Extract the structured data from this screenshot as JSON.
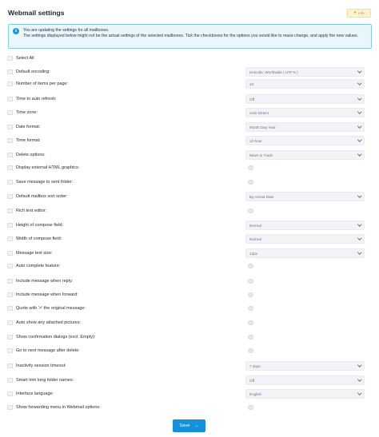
{
  "page": {
    "title": "Webmail settings",
    "info_label": "Info"
  },
  "notice": {
    "line1": "You are updating the settings for all mailboxes.",
    "line2": "The settings displayed below might not be the actual settings of the selected mailboxes. Tick the checkboxes for the options you would like to mass-change, and apply the new values."
  },
  "select_all": "Select All",
  "settings": [
    {
      "label": "Default encoding:",
      "type": "select",
      "value": "Unicode, Worldwide ( UTF-8 )"
    },
    {
      "label": "Number of items per page:",
      "type": "select",
      "value": "10"
    },
    {
      "label": "Time to auto refresh:",
      "type": "select",
      "value": "Off"
    },
    {
      "label": "Time zone:",
      "type": "select",
      "value": "Auto Detect"
    },
    {
      "label": "Date format:",
      "type": "select",
      "value": "Month Day Year"
    },
    {
      "label": "Time format:",
      "type": "select",
      "value": "12-hour"
    },
    {
      "label": "Delete options:",
      "type": "select",
      "value": "Move to Trash"
    },
    {
      "label": "Display external HTML graphics:",
      "type": "toggle"
    },
    {
      "label": "Save message to sent folder:",
      "type": "toggle"
    },
    {
      "label": "Default mailbox sort order:",
      "type": "select",
      "value": "By Arrival Date"
    },
    {
      "label": "Rich text editor:",
      "type": "toggle"
    },
    {
      "label": "Height of compose field:",
      "type": "select",
      "value": "Normal"
    },
    {
      "label": "Width of compose field:",
      "type": "select",
      "value": "Normal"
    },
    {
      "label": "Message text size:",
      "type": "select",
      "value": "12px"
    },
    {
      "label": "Auto complete feature:",
      "type": "toggle"
    },
    {
      "label": "Include message when reply:",
      "type": "toggle"
    },
    {
      "label": "Include message when forward:",
      "type": "toggle"
    },
    {
      "label": "Quote with '>' the original message:",
      "type": "toggle"
    },
    {
      "label": "Auto show any attached pictures:",
      "type": "toggle"
    },
    {
      "label": "Show confirmation dialogs (excl. Empty):",
      "type": "toggle"
    },
    {
      "label": "Go to next message after delete:",
      "type": "toggle"
    },
    {
      "label": "Inactivity session timeout:",
      "type": "select",
      "value": "7 days"
    },
    {
      "label": "Smart trim long folder names:",
      "type": "select",
      "value": "Off"
    },
    {
      "label": "Interface language:",
      "type": "select",
      "value": "English"
    },
    {
      "label": "Show forwarding menu in Webmail options:",
      "type": "toggle"
    }
  ],
  "save_label": "Save"
}
